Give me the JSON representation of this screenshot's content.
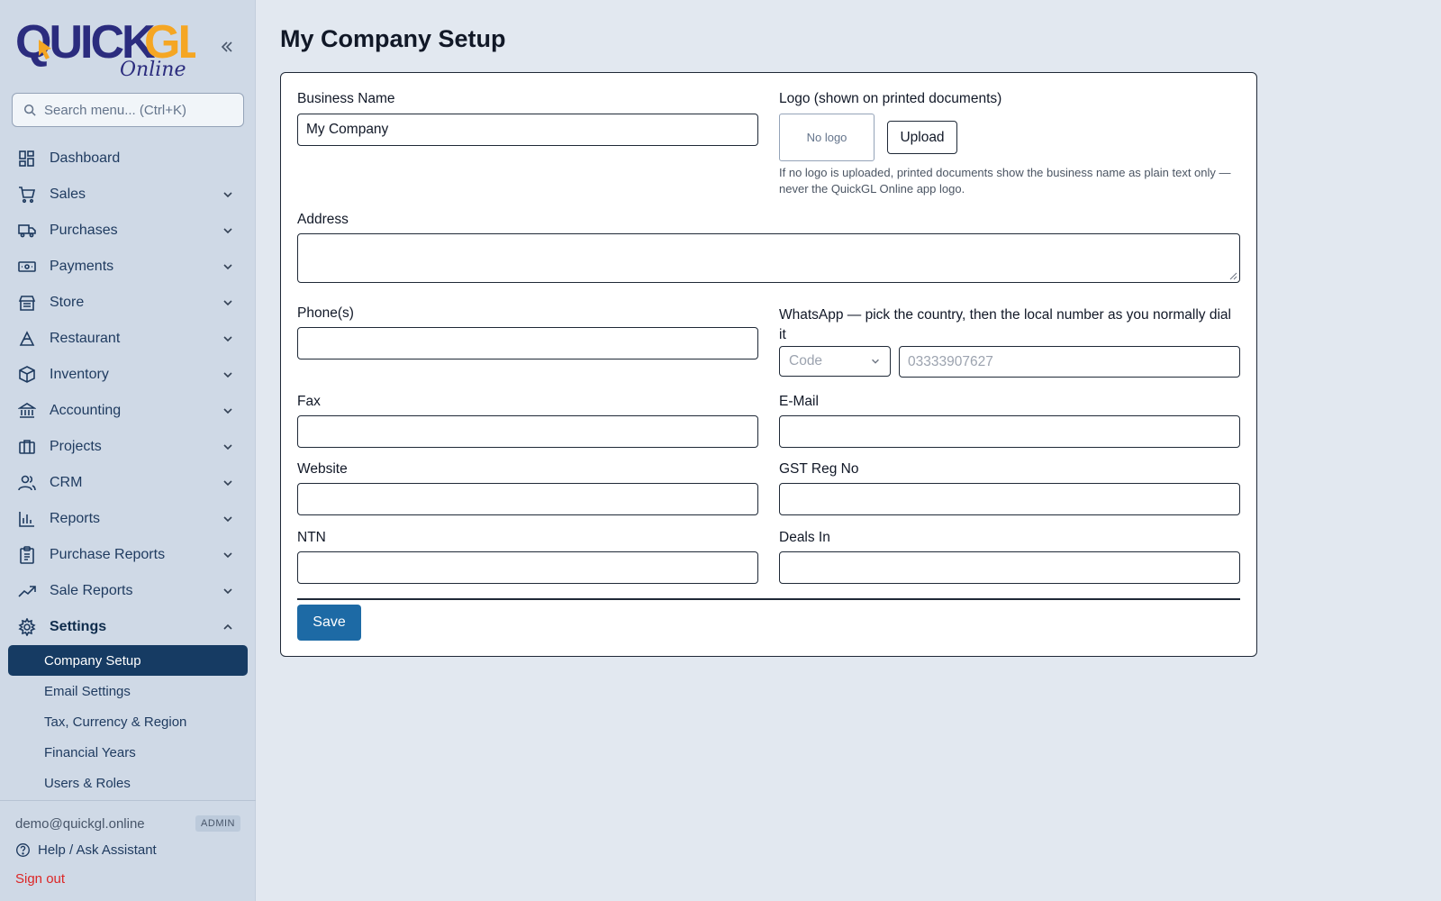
{
  "brand": {
    "logo_main": "QuickGL",
    "logo_sub": "Online",
    "colors": {
      "navy": "#2b2c7e",
      "orange": "#f5a623",
      "active": "#163b63",
      "save": "#1d6aa5",
      "signout": "#dc2626"
    }
  },
  "search": {
    "placeholder": "Search menu... (Ctrl+K)"
  },
  "nav": {
    "items": [
      {
        "label": "Dashboard",
        "icon": "dashboard-icon"
      },
      {
        "label": "Sales",
        "icon": "cart-icon"
      },
      {
        "label": "Purchases",
        "icon": "truck-icon"
      },
      {
        "label": "Payments",
        "icon": "banknote-icon"
      },
      {
        "label": "Store",
        "icon": "store-icon"
      },
      {
        "label": "Restaurant",
        "icon": "utensils-icon"
      },
      {
        "label": "Inventory",
        "icon": "package-icon"
      },
      {
        "label": "Accounting",
        "icon": "bank-icon"
      },
      {
        "label": "Projects",
        "icon": "briefcase-icon"
      },
      {
        "label": "CRM",
        "icon": "users-icon"
      },
      {
        "label": "Reports",
        "icon": "bar-chart-icon"
      },
      {
        "label": "Purchase Reports",
        "icon": "clipboard-icon"
      },
      {
        "label": "Sale Reports",
        "icon": "trending-up-icon"
      },
      {
        "label": "Settings",
        "icon": "gear-icon"
      }
    ],
    "settings_sub": [
      {
        "label": "Company Setup"
      },
      {
        "label": "Email Settings"
      },
      {
        "label": "Tax, Currency & Region"
      },
      {
        "label": "Financial Years"
      },
      {
        "label": "Users & Roles"
      }
    ]
  },
  "footer": {
    "email": "demo@quickgl.online",
    "role": "ADMIN",
    "help": "Help / Ask Assistant",
    "signout": "Sign out"
  },
  "page": {
    "title": "My Company Setup"
  },
  "form": {
    "business_name_label": "Business Name",
    "business_name_value": "My Company",
    "logo_label": "Logo (shown on printed documents)",
    "logo_placeholder": "No logo",
    "upload_label": "Upload",
    "logo_hint": "If no logo is uploaded, printed documents show the business name as plain text only — never the QuickGL Online app logo.",
    "address_label": "Address",
    "phones_label": "Phone(s)",
    "whatsapp_label": "WhatsApp — pick the country, then the local number as you normally dial it",
    "code_placeholder": "Code",
    "whatsapp_placeholder": "03333907627",
    "fax_label": "Fax",
    "email_label": "E-Mail",
    "website_label": "Website",
    "gst_label": "GST Reg No",
    "ntn_label": "NTN",
    "deals_label": "Deals In",
    "save_label": "Save"
  }
}
